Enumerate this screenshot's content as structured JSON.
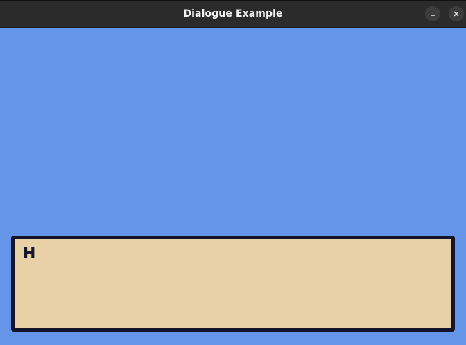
{
  "window": {
    "title": "Dialogue Example",
    "buttons": {
      "minimize_icon": "minimize-icon",
      "close_icon": "close-icon"
    }
  },
  "scene": {
    "background_color": "#6495e8"
  },
  "dialogue": {
    "text": "H",
    "box_color": "#e8d1a7",
    "border_color": "#14142a"
  }
}
